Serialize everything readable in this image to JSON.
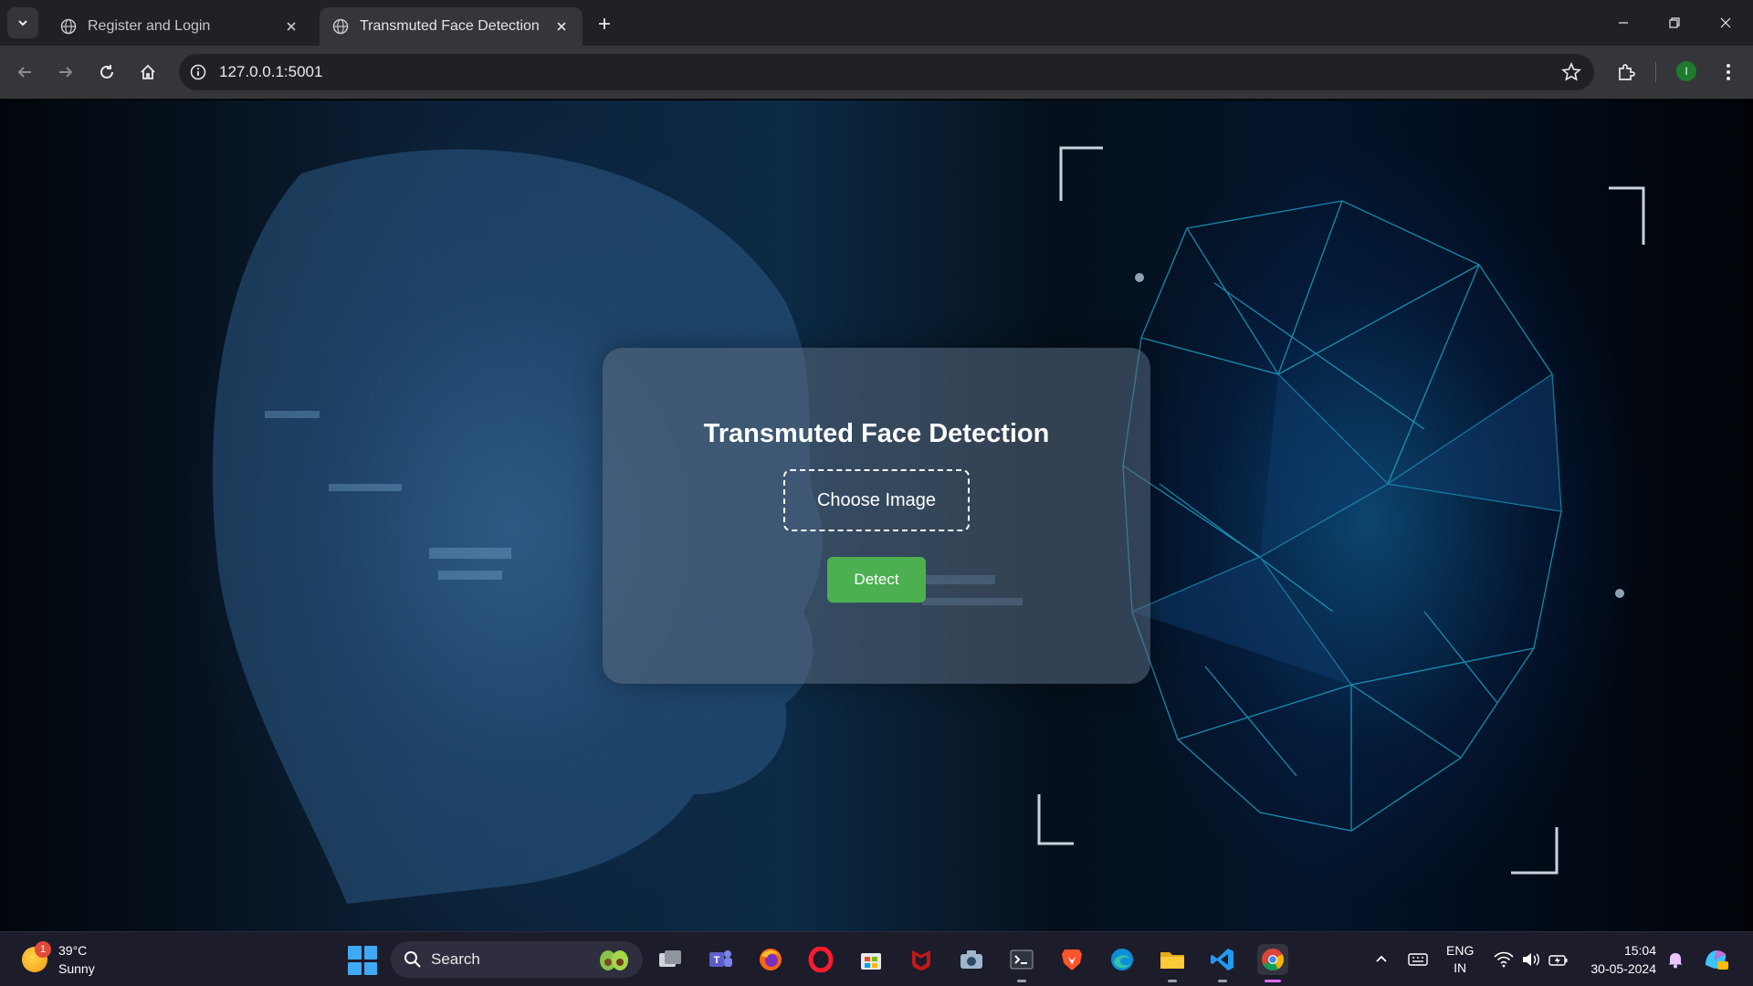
{
  "browser": {
    "tabs": [
      {
        "title": "Register and Login",
        "active": false
      },
      {
        "title": "Transmuted Face Detection",
        "active": true
      }
    ],
    "url": "127.0.0.1:5001",
    "profile_initial": "I"
  },
  "page": {
    "title": "Transmuted Face Detection",
    "choose_label": "Choose Image",
    "detect_label": "Detect",
    "detect_color": "#4caf50"
  },
  "taskbar": {
    "weather": {
      "temp": "39°C",
      "condition": "Sunny",
      "badge": "1"
    },
    "search_label": "Search",
    "lang": {
      "line1": "ENG",
      "line2": "IN"
    },
    "clock": {
      "time": "15:04",
      "date": "30-05-2024"
    },
    "apps": [
      "task-view",
      "teams",
      "firefox",
      "opera",
      "microsoft-store",
      "mcafee",
      "camera",
      "terminal",
      "brave",
      "edge",
      "file-explorer",
      "vscode",
      "chrome"
    ]
  }
}
